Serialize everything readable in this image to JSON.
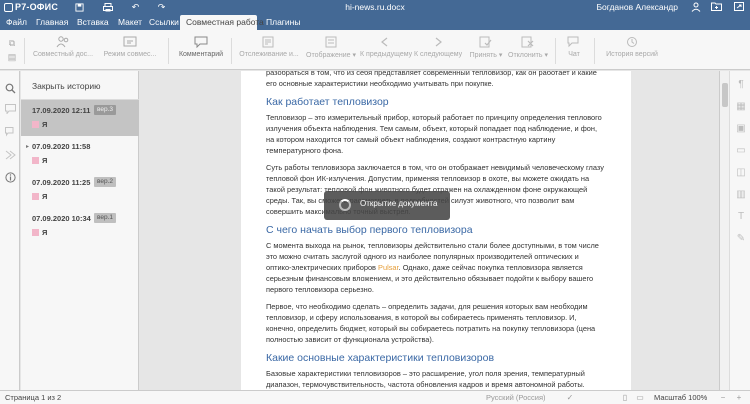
{
  "app": {
    "logo": "Р7-ОФИС",
    "document_title": "hi-news.ru.docx",
    "user_name": "Богданов Александр"
  },
  "quick_access_icons": [
    "save-icon",
    "print-icon",
    "undo-icon",
    "redo-icon"
  ],
  "title_right_icons": [
    "user-icon",
    "open-location-icon",
    "fullscreen-icon"
  ],
  "menu_tabs": [
    {
      "label": "Файл"
    },
    {
      "label": "Главная"
    },
    {
      "label": "Вставка"
    },
    {
      "label": "Макет"
    },
    {
      "label": "Ссылки"
    },
    {
      "label": "Совместная работа",
      "active": true
    },
    {
      "label": "Плагины"
    }
  ],
  "toolbar": {
    "co_editing": "Совместный дос...",
    "editing_mode": "Режим совмес...",
    "comment": "Комментарий",
    "track_changes": "Отслеживание и...",
    "display": "Отображение",
    "prev": "К предыдущему",
    "next": "К следующему",
    "accept": "Принять",
    "reject": "Отклонить",
    "chat": "Чат",
    "version_history": "История версий"
  },
  "history": {
    "close_label": "Закрыть историю",
    "versions": [
      {
        "date": "17.09.2020 12:11",
        "badge": "вер.3",
        "user": "Я",
        "selected": true
      },
      {
        "date": "07.09.2020 11:58",
        "badge": "",
        "user": "Я",
        "selected": false
      },
      {
        "date": "07.09.2020 11:25",
        "badge": "вер.2",
        "user": "Я",
        "selected": false
      },
      {
        "date": "07.09.2020 10:34",
        "badge": "вер.1",
        "user": "Я",
        "selected": false
      }
    ],
    "user_color": "#f2b6c9"
  },
  "document": {
    "top_text": "разобраться в том, что из себя представляет современный тепловизор, как он работает и какие его основные характеристики необходимо учитывать при покупке.",
    "h1": "Как работает тепловизор",
    "p1": "Тепловизор – это измерительный прибор, который работает по принципу определения теплового излучения объекта наблюдения. Тем самым, объект, который попадает под наблюдение, и фон, на котором находится тот самый объект наблюдения, создают контрастную картину температурного фона.",
    "p2": "Суть работы тепловизора заключается в том, что он отображает невидимый человеческому глазу тепловой фон ИК-излучения. Допустим, применяя тепловизор в охоте, вы можете ожидать на такой результат: тепловой фон животного будет отражен на охлажденном фоне окружающей среды. Так, вы сможете рассмотреть в подробностей силуэт животного, что позволит вам совершить максимально точный выстрел.",
    "h2": "С чего начать выбор первого тепловизора",
    "p3_before": "С момента выхода на рынок, тепловизоры действительно стали более доступными, в том числе это можно считать заслугой одного из наиболее популярных производителей оптических и оптико-электрических приборов ",
    "p3_link": "Pulsar",
    "p3_after": ". Однако, даже сейчас покупка тепловизора является серьезным финансовым вложением, и это действительно обязывает подойти к выбору вашего первого тепловизора серьезно.",
    "p4": "Первое, что необходимо сделать – определить задачи, для решения которых вам необходим тепловизор, и сферу использования, в которой вы собираетесь применять тепловизор. И, конечно, определить бюджет, который вы собираетесь потратить на покупку тепловизора (цена полностью зависит от функционала устройства).",
    "h3": "Какие основные характеристики тепловизоров",
    "p5": "Базовые характеристики тепловизоров – это расширение, угол поля зрения, температурный диапазон, термочувствительность, частота обновления кадров и время автономной работы."
  },
  "loading": {
    "text": "Открытие документа"
  },
  "statusbar": {
    "page_info": "Страница 1 из 2",
    "language": "Русский (Россия)",
    "zoom": "Масштаб 100%"
  }
}
